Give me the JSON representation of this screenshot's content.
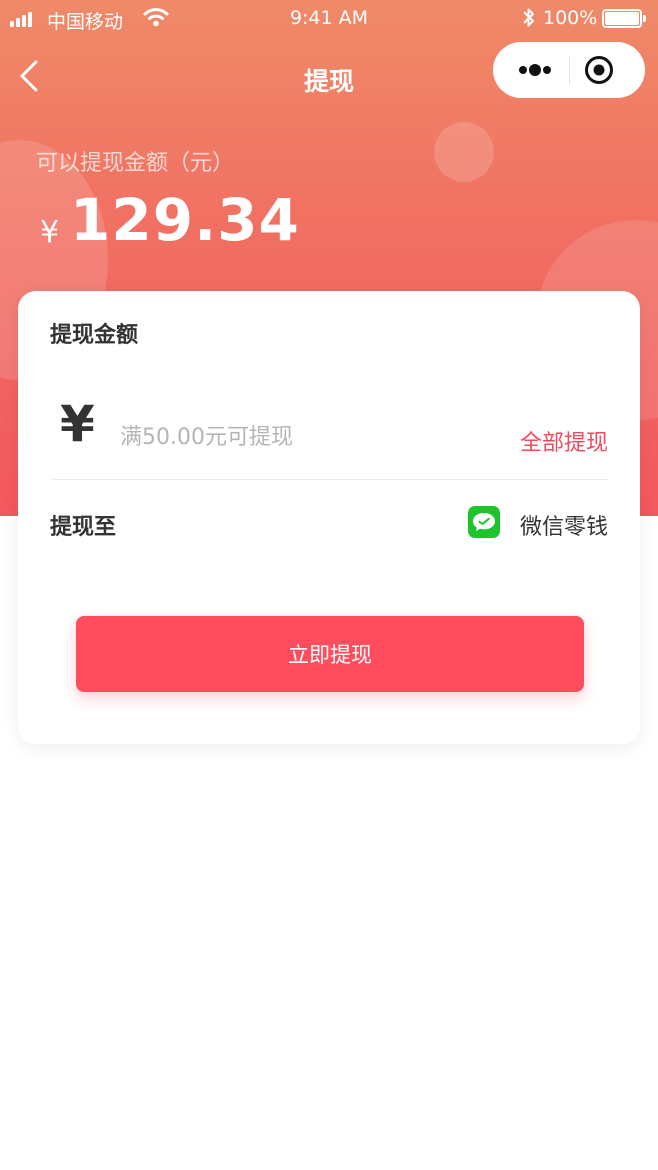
{
  "status_bar": {
    "carrier": "中国移动",
    "time": "9:41 AM",
    "battery_percent": "100%"
  },
  "nav": {
    "title": "提现"
  },
  "balance": {
    "label": "可以提现金额（元）",
    "currency_symbol": "¥",
    "amount": "129.34"
  },
  "withdraw_card": {
    "title": "提现金额",
    "currency_symbol": "¥",
    "amount_value": "",
    "amount_placeholder": "满50.00元可提现",
    "withdraw_all_label": "全部提现",
    "destination_label": "提现至",
    "destination_value": "微信零钱",
    "submit_label": "立即提现"
  },
  "colors": {
    "header_gradient_top": "#ef8a68",
    "header_gradient_bottom": "#f3585e",
    "accent_red": "#ff4d5e",
    "link_red": "#f04a5e",
    "wechat_green": "#1ec42b"
  },
  "icons": {
    "back": "chevron-left-icon",
    "more": "more-dots-icon",
    "close_miniprogram": "target-icon",
    "wechat_pay": "wechat-icon"
  }
}
